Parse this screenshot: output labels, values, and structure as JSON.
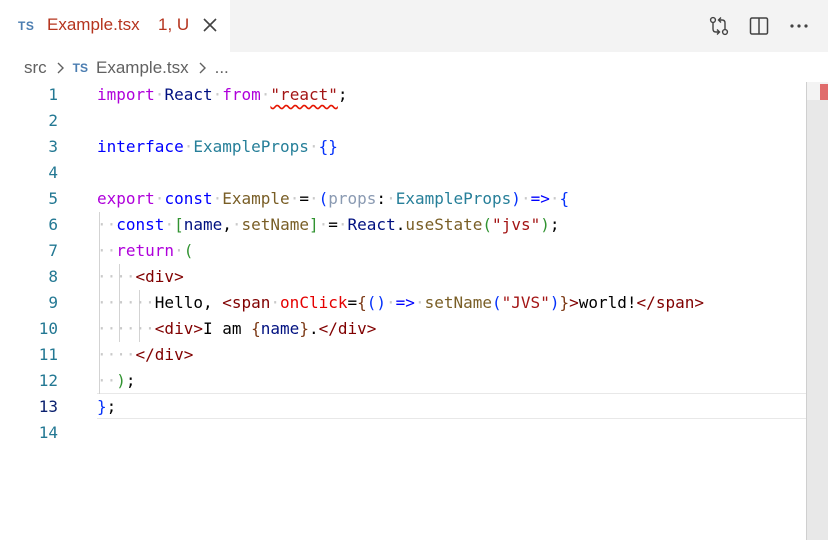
{
  "tab": {
    "lang_badge": "TS",
    "filename": "Example.tsx",
    "status": "1, U"
  },
  "actions": [
    {
      "name": "compare-changes-icon"
    },
    {
      "name": "split-editor-icon"
    },
    {
      "name": "more-actions-icon"
    }
  ],
  "breadcrumb": {
    "folder": "src",
    "lang_badge": "TS",
    "file": "Example.tsx",
    "tail": "..."
  },
  "editor": {
    "line_numbers": [
      "1",
      "2",
      "3",
      "4",
      "5",
      "6",
      "7",
      "8",
      "9",
      "10",
      "11",
      "12",
      "13",
      "14"
    ],
    "active_line": 13,
    "lines": [
      "import React from \"react\";",
      "",
      "interface ExampleProps {}",
      "",
      "export const Example = (props: ExampleProps) => {",
      "  const [name, setName] = React.useState(\"jvs\");",
      "  return (",
      "    <div>",
      "      Hello, <span onClick={() => setName(\"JVS\")}>world!</span>",
      "      <div>I am {name}.</div>",
      "    </div>",
      "  );",
      "};",
      ""
    ]
  },
  "colors": {
    "error": "#e51400",
    "tab_text": "#b5341e",
    "line_number": "#237893"
  }
}
